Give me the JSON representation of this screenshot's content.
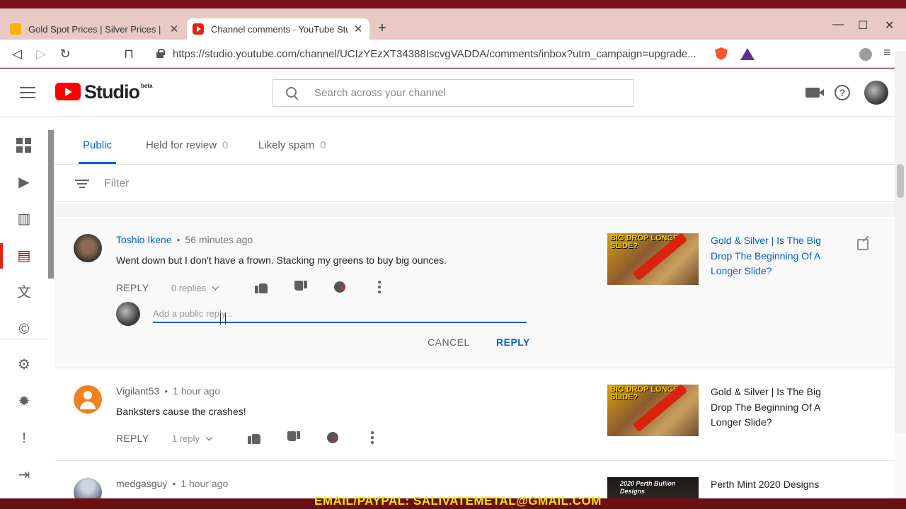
{
  "browser": {
    "tabs": [
      {
        "title": "Gold Spot Prices | Silver Prices | Pla",
        "close": "✕"
      },
      {
        "title": "Channel comments - YouTube Stu",
        "close": "✕"
      }
    ],
    "new_tab": "+",
    "window_controls": {
      "minimize": "—",
      "maximize": "☐",
      "close": "✕"
    },
    "nav": {
      "back": "◁",
      "forward": "▷",
      "reload": "↻",
      "bookmark": "⊓"
    },
    "url": "https://studio.youtube.com/channel/UCIzYEzXT34388IscvgVADDA/comments/inbox?utm_campaign=upgrade...",
    "menu": "≡"
  },
  "header": {
    "logo_text": "Studio",
    "logo_badge": "beta",
    "search_placeholder": "Search across your channel",
    "help": "?"
  },
  "sidebar": {
    "items": [
      {
        "icon": "dashboard-icon",
        "glyph": ""
      },
      {
        "icon": "videos-icon",
        "glyph": "▶"
      },
      {
        "icon": "analytics-icon",
        "glyph": "▥"
      },
      {
        "icon": "comments-icon",
        "glyph": "▤"
      },
      {
        "icon": "translations-icon",
        "glyph": "文"
      },
      {
        "icon": "copyright-icon",
        "glyph": "©"
      },
      {
        "icon": "settings-icon",
        "glyph": "⚙"
      },
      {
        "icon": "warning-icon",
        "glyph": "✹"
      },
      {
        "icon": "feedback-icon",
        "glyph": "!"
      },
      {
        "icon": "creator-studio-classic-icon",
        "glyph": "⇥"
      }
    ],
    "active_index": 3
  },
  "comments_page": {
    "tabs": [
      {
        "label": "Public",
        "count": ""
      },
      {
        "label": "Held for review",
        "count": "0"
      },
      {
        "label": "Likely spam",
        "count": "0"
      }
    ],
    "filter_placeholder": "Filter",
    "reply_label": "REPLY",
    "reply_box": {
      "placeholder": "Add a public reply...",
      "cancel": "CANCEL",
      "submit": "REPLY"
    },
    "comments": [
      {
        "author": "Toshio Ikene",
        "time": "56 minutes ago",
        "text": "Went down but I don't have a frown. Stacking my greens to buy big ounces.",
        "replies": "0 replies",
        "video_title": "Gold & Silver | Is The Big Drop The Beginning Of A Longer Slide?",
        "thumb_text": "BIG DROP LONGER SLIDE?"
      },
      {
        "author": "Vigilant53",
        "time": "1 hour ago",
        "text": "Banksters cause the crashes!",
        "replies": "1 reply",
        "video_title": "Gold & Silver | Is The Big Drop The Beginning Of A Longer Slide?",
        "thumb_text": "BIG DROP LONGER SLIDE?"
      },
      {
        "author": "medgasguy",
        "time": "1 hour ago",
        "text": "",
        "replies": "",
        "video_title": "Perth Mint 2020 Designs",
        "thumb_text": "2020 Perth Bullion Designs"
      }
    ]
  },
  "overlay": {
    "banner_text": "EMAIL/PAYPAL: SALIVATEMETAL@GMAIL.COM"
  },
  "colors": {
    "accent_blue": "#065fd4",
    "brand_red": "#ff0000",
    "frame": "#6b0f14"
  }
}
